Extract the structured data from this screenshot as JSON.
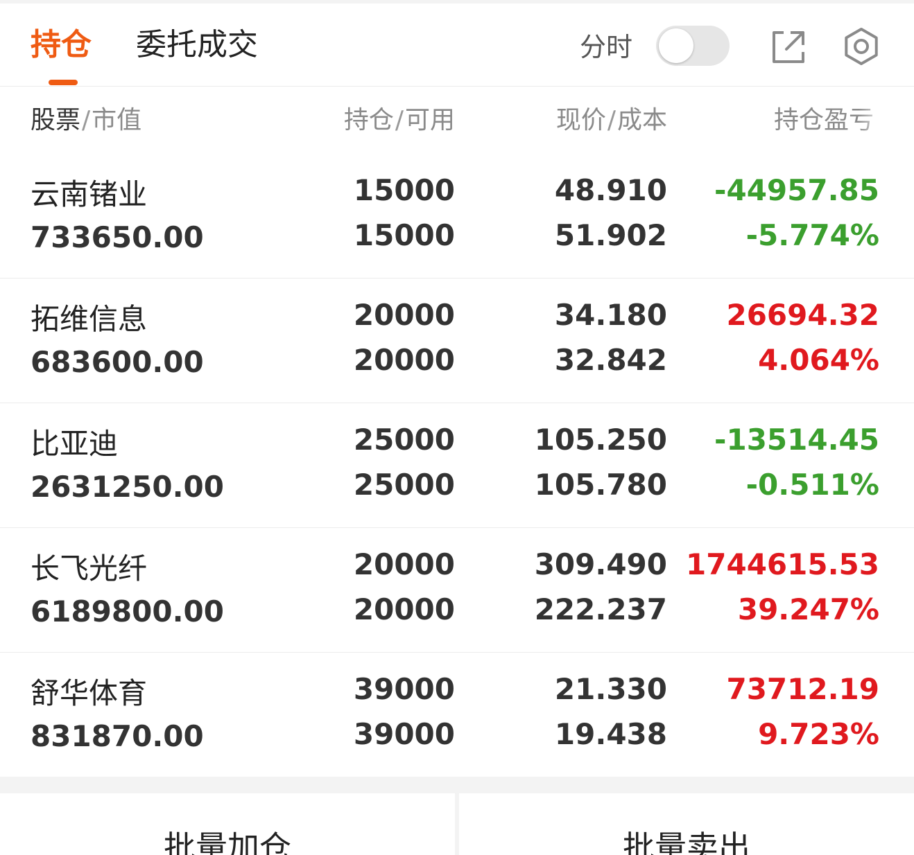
{
  "tabs": {
    "holdings": "持仓",
    "orders": "委托成交"
  },
  "header": {
    "fenshi_label": "分时",
    "fenshi_on": false
  },
  "columns": {
    "c1_main": "股票",
    "c1_sub": "市值",
    "c2_main": "持仓",
    "c2_sub": "可用",
    "c3_main": "现价",
    "c3_sub": "成本",
    "c4": "持仓盈亏",
    "sep": "/"
  },
  "rows": [
    {
      "name": "云南锗业",
      "market_value": "733650.00",
      "position": "15000",
      "available": "15000",
      "price": "48.910",
      "cost": "51.902",
      "pnl": "-44957.85",
      "pnl_pct": "-5.774%",
      "trend": "down"
    },
    {
      "name": "拓维信息",
      "market_value": "683600.00",
      "position": "20000",
      "available": "20000",
      "price": "34.180",
      "cost": "32.842",
      "pnl": "26694.32",
      "pnl_pct": "4.064%",
      "trend": "up"
    },
    {
      "name": "比亚迪",
      "market_value": "2631250.00",
      "position": "25000",
      "available": "25000",
      "price": "105.250",
      "cost": "105.780",
      "pnl": "-13514.45",
      "pnl_pct": "-0.511%",
      "trend": "down"
    },
    {
      "name": "长飞光纤",
      "market_value": "6189800.00",
      "position": "20000",
      "available": "20000",
      "price": "309.490",
      "cost": "222.237",
      "pnl": "1744615.53",
      "pnl_pct": "39.247%",
      "trend": "up"
    },
    {
      "name": "舒华体育",
      "market_value": "831870.00",
      "position": "39000",
      "available": "39000",
      "price": "21.330",
      "cost": "19.438",
      "pnl": "73712.19",
      "pnl_pct": "9.723%",
      "trend": "up"
    }
  ],
  "actions": {
    "batch_add": "批量加仓",
    "batch_sell": "批量卖出"
  },
  "colors": {
    "accent": "#ef5b13",
    "up": "#e0191e",
    "down": "#3b9f2e"
  },
  "icons": [
    "share-icon",
    "settings-gear-icon"
  ]
}
